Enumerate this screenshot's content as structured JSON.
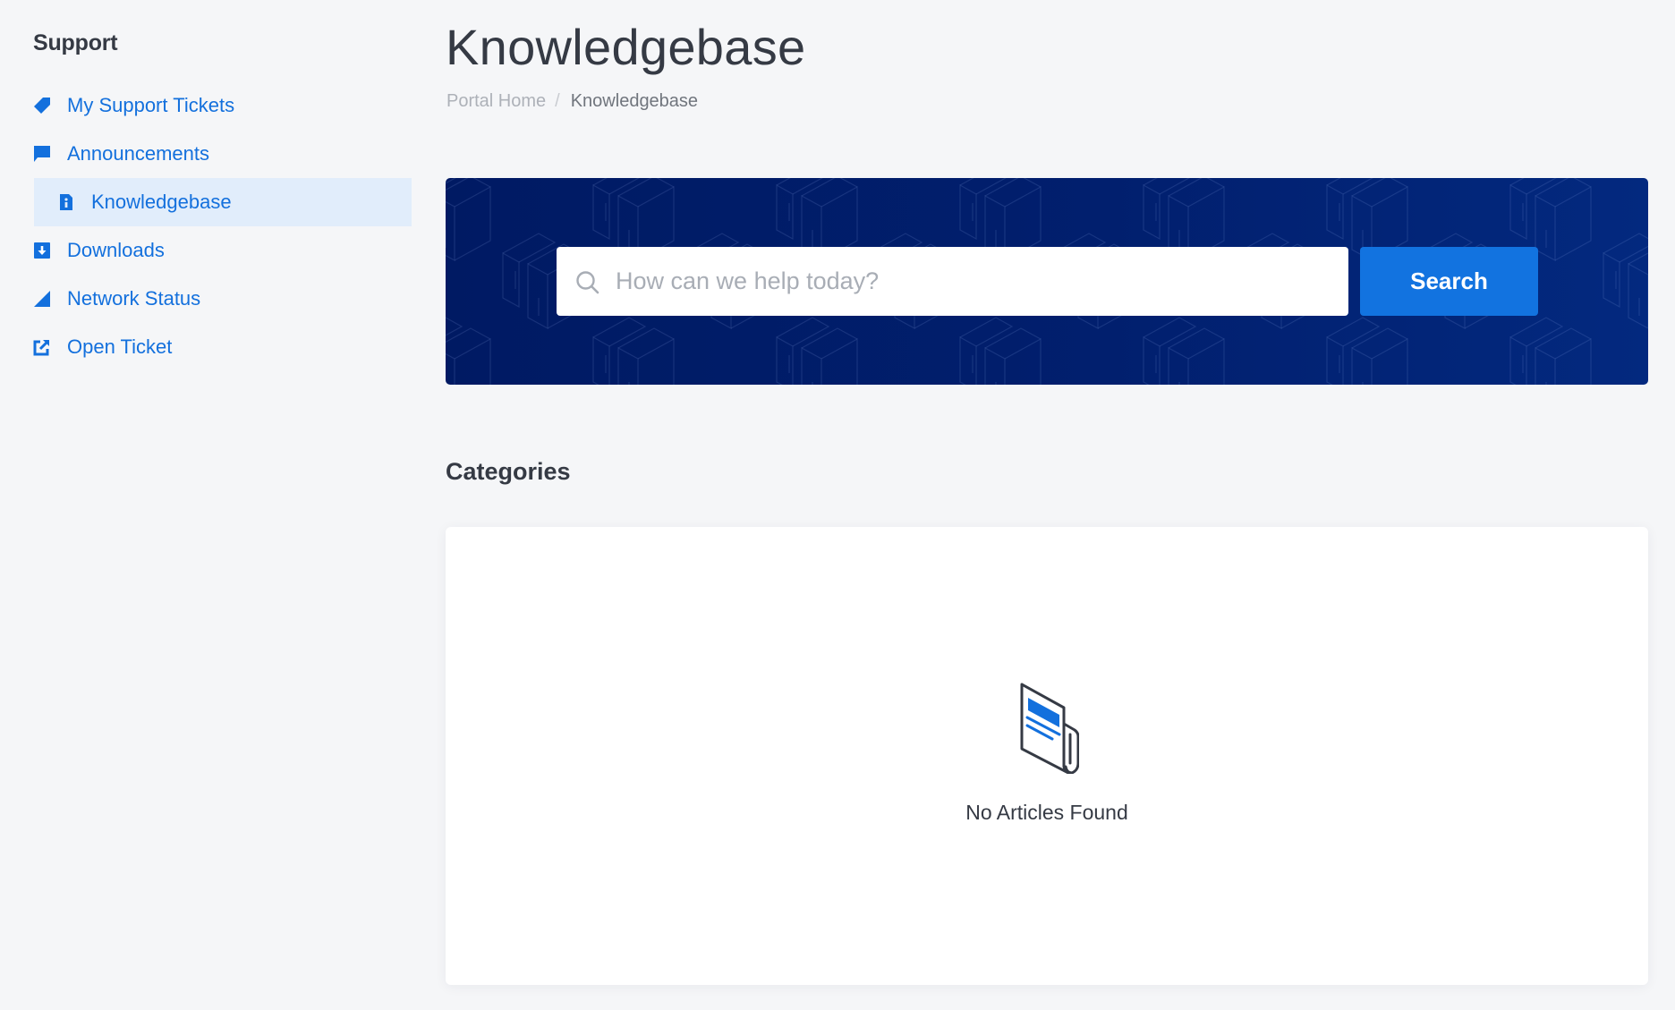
{
  "sidebar": {
    "title": "Support",
    "items": [
      {
        "label": "My Support Tickets",
        "icon": "tag-icon",
        "active": false
      },
      {
        "label": "Announcements",
        "icon": "comment-icon",
        "active": false
      },
      {
        "label": "Knowledgebase",
        "icon": "info-file-icon",
        "active": true
      },
      {
        "label": "Downloads",
        "icon": "download-icon",
        "active": false
      },
      {
        "label": "Network Status",
        "icon": "signal-icon",
        "active": false
      },
      {
        "label": "Open Ticket",
        "icon": "external-link-icon",
        "active": false
      }
    ]
  },
  "header": {
    "title": "Knowledgebase",
    "breadcrumb": [
      {
        "label": "Portal Home",
        "link": true
      },
      {
        "label": "Knowledgebase",
        "link": false
      }
    ],
    "breadcrumb_separator": "/"
  },
  "search": {
    "placeholder": "How can we help today?",
    "value": "",
    "button_label": "Search",
    "icon": "search-icon"
  },
  "categories": {
    "title": "Categories",
    "empty_icon": "newspaper-icon",
    "empty_text": "No Articles Found"
  },
  "colors": {
    "accent": "#1370dd",
    "button": "#1273e0",
    "banner_dark": "#001a63",
    "banner_light": "#03297f",
    "active_item_bg": "#e1edfb",
    "page_bg": "#f5f6f8",
    "text_dark": "#353a44"
  }
}
